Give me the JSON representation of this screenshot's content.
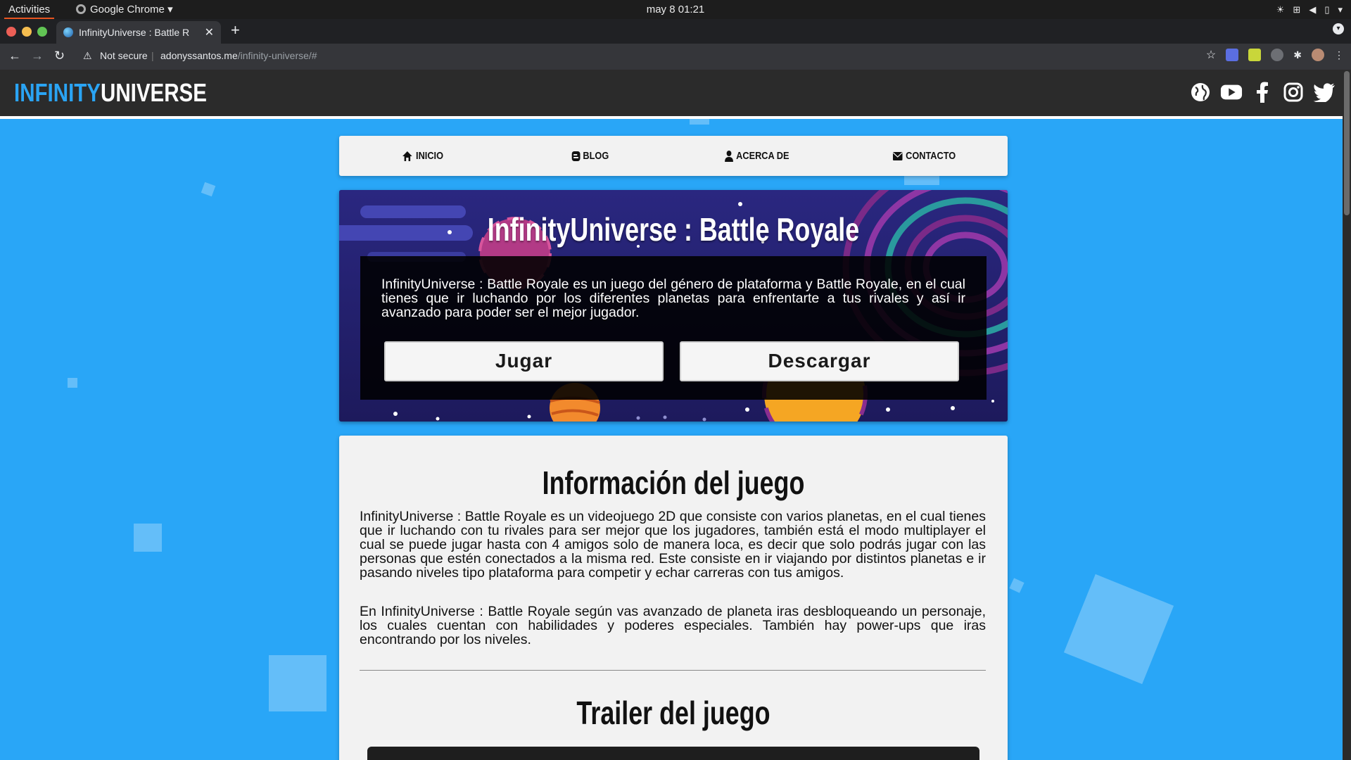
{
  "os": {
    "activities": "Activities",
    "app_name": "Google Chrome",
    "clock": "may 8  01:21"
  },
  "browser": {
    "tab_title": "InfinityUniverse : Battle R",
    "not_secure": "Not secure",
    "url_host": "adonyssantos.me",
    "url_path": "/infinity-universe/#"
  },
  "site": {
    "logo_part1": "INFINITY",
    "logo_part2": "UNIVERSE",
    "nav": [
      {
        "label": "INICIO",
        "icon": "home-icon"
      },
      {
        "label": "BLOG",
        "icon": "blog-icon"
      },
      {
        "label": "ACERCA DE",
        "icon": "user-icon"
      },
      {
        "label": "CONTACTO",
        "icon": "envelope-icon"
      }
    ],
    "social_icons": [
      "globe-icon",
      "youtube-icon",
      "facebook-icon",
      "instagram-icon",
      "twitter-icon"
    ]
  },
  "hero": {
    "title": "InfinityUniverse : Battle Royale",
    "text": "InfinityUniverse : Battle Royale es un juego del género de plataforma y Battle Royale, en el cual tienes que ir luchando por los diferentes planetas para enfrentarte a tus rivales y así ir avanzado para poder ser el mejor jugador.",
    "play_button": "Jugar",
    "download_button": "Descargar"
  },
  "info": {
    "heading": "Información del juego",
    "paragraph1": "InfinityUniverse : Battle Royale es un videojuego 2D que consiste con varios planetas, en el cual tienes que ir luchando con tu rivales para ser mejor que los jugadores, también está el modo multiplayer el cual se puede jugar hasta con 4 amigos solo de manera loca, es decir que solo podrás jugar con las personas que estén conectados a la misma red. Este consiste en ir viajando por distintos planetas e ir pasando niveles tipo plataforma para competir y echar carreras con tus amigos.",
    "paragraph2": "En InfinityUniverse : Battle Royale según vas avanzado de planeta iras desbloqueando un personaje, los cuales cuentan con habilidades y poderes especiales. También hay power-ups que iras encontrando por los niveles.",
    "trailer_heading": "Trailer del juego"
  },
  "colors": {
    "page_bg": "#29a6f7",
    "logo_accent": "#2aa4f4",
    "header_bg": "#2b2b2b",
    "hero_bg": "#23206e"
  }
}
